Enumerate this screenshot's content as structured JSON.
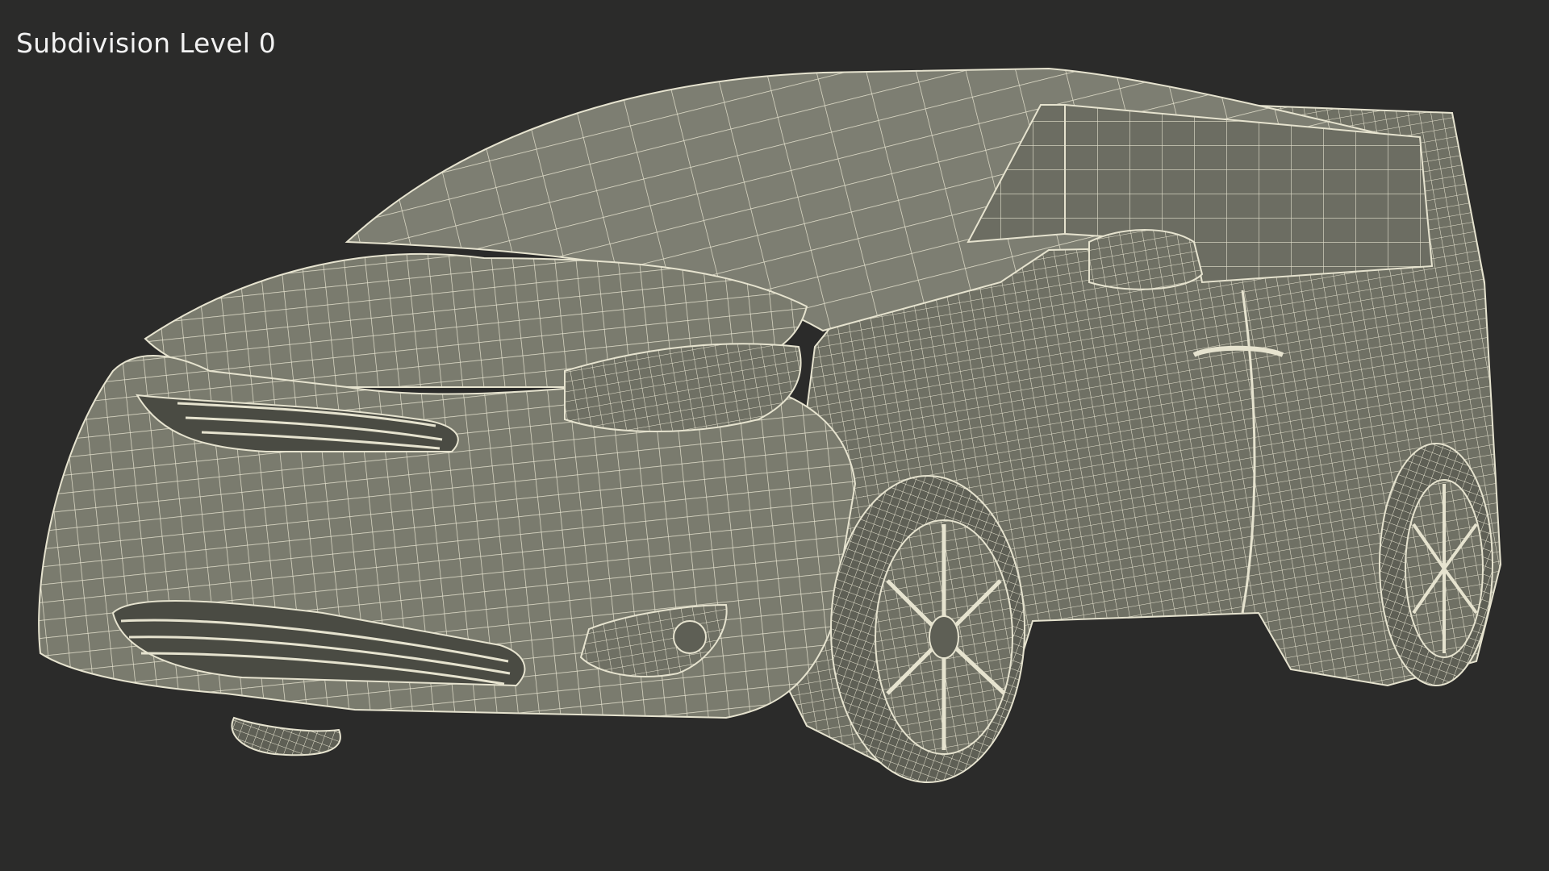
{
  "viewport": {
    "overlay_label": "Subdivision Level 0",
    "background_color": "#2b2b2a",
    "render_subject": "wireframe-minivan",
    "surface_color": "#7a7b6e",
    "wire_color": "#e6e3cf"
  }
}
